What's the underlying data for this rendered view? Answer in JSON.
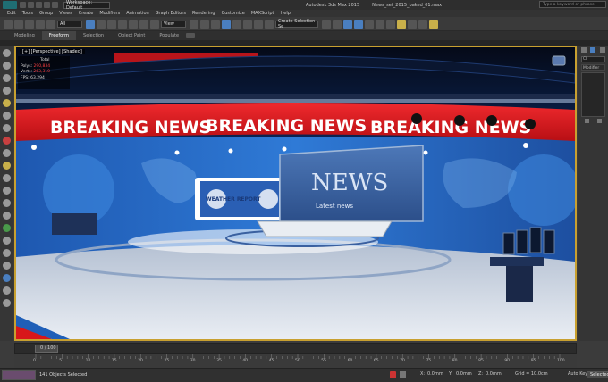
{
  "title_bar": {
    "workspace": "Workspace: Default",
    "app_title": "Autodesk 3ds Max 2015",
    "file_name": "News_set_2015_baked_01.max",
    "search_placeholder": "Type a keyword or phrase"
  },
  "menu": [
    "Edit",
    "Tools",
    "Group",
    "Views",
    "Create",
    "Modifiers",
    "Animation",
    "Graph Editors",
    "Rendering",
    "Customize",
    "MAXScript",
    "Help"
  ],
  "toolbar": {
    "selection_filter": "All",
    "ref_coord": "View",
    "selection_set": "Create Selection Se"
  },
  "ribbon": {
    "tabs": [
      "Modeling",
      "Freeform",
      "Selection",
      "Object Paint",
      "Populate"
    ],
    "active": 1
  },
  "viewport": {
    "label": "[+] [Perspective] [Shaded]",
    "stats_header": "Total",
    "polys_label": "Polys:",
    "polys_value": "290,834",
    "verts_label": "Verts:",
    "verts_value": "263,310",
    "fps_label": "FPS:",
    "fps_value": "63.294",
    "banner_text": "BREAKING NEWS",
    "news_screen_title": "NEWS",
    "news_screen_sub": "Latest news",
    "panel_left_text": "WEATHER REPORT",
    "panel_right_text": "WEATHER REPORT"
  },
  "command_panel": {
    "object_field": "Cl",
    "modifier_list": "Modifier List"
  },
  "time_slider": {
    "frame_text": "0 / 100"
  },
  "trackbar": {
    "ticks": [
      "0",
      "5",
      "10",
      "15",
      "20",
      "25",
      "30",
      "35",
      "40",
      "45",
      "50",
      "55",
      "60",
      "65",
      "70",
      "75",
      "80",
      "85",
      "90",
      "95",
      "100"
    ]
  },
  "status": {
    "objects_selected": "141 Objects Selected",
    "x_label": "X:",
    "x_value": "0.0mm",
    "y_label": "Y:",
    "y_value": "0.0mm",
    "z_label": "Z:",
    "z_value": "0.0mm",
    "grid": "Grid = 10.0cm",
    "auto_key": "Auto Key",
    "selected_btn": "Selected"
  },
  "colors": {
    "viewport_border": "#c8a030",
    "banner_red": "#d8161a",
    "set_blue": "#1f5fb8"
  }
}
